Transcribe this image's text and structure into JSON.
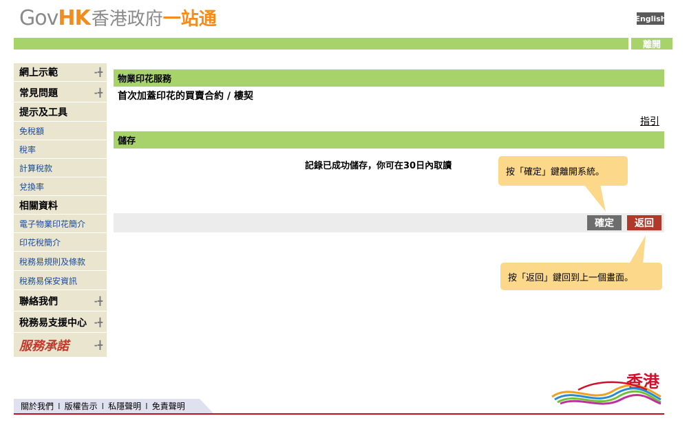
{
  "header": {
    "logo_gov": "Gov",
    "logo_hk": "HK",
    "logo_cn_grey": "香港政府",
    "logo_cn_orange": "一站通",
    "lang_button": "English",
    "exit_button": "離開"
  },
  "sidebar": {
    "items": [
      {
        "label": "網上示範",
        "type": "head",
        "arrow": true
      },
      {
        "label": "常見問題",
        "type": "head",
        "arrow": true
      },
      {
        "label": "提示及工具",
        "type": "head",
        "arrow": false
      },
      {
        "label": "免稅額",
        "type": "link"
      },
      {
        "label": "稅率",
        "type": "link"
      },
      {
        "label": "計算稅款",
        "type": "link"
      },
      {
        "label": "兌換率",
        "type": "link"
      },
      {
        "label": "相關資料",
        "type": "head",
        "arrow": false
      },
      {
        "label": "電子物業印花簡介",
        "type": "link"
      },
      {
        "label": "印花稅簡介",
        "type": "link"
      },
      {
        "label": "稅務易規則及條款",
        "type": "link"
      },
      {
        "label": "稅務易保安資訊",
        "type": "link"
      },
      {
        "label": "聯絡我們",
        "type": "head",
        "arrow": true
      },
      {
        "label": "稅務易支援中心",
        "type": "head",
        "arrow": true
      },
      {
        "label": "服務承諾",
        "type": "logo",
        "arrow": true
      }
    ],
    "arrow_glyph": "-╋"
  },
  "main": {
    "section_title": "物業印花服務",
    "subtitle": "首次加蓋印花的買賣合約 / 樓契",
    "guide_link": "指引",
    "save_section": "儲存",
    "message": "記錄已成功儲存，你可在30日內取讀",
    "ok_button": "確定",
    "back_button": "返回",
    "tip_ok": "按「確定」鍵離開系統。",
    "tip_back": "按「返回」鍵回到上一個畫面。"
  },
  "footer": {
    "links": [
      "關於我們",
      "版權告示",
      "私隱聲明",
      "免責聲明"
    ],
    "separator": "I",
    "brand_text": "香港"
  },
  "colors": {
    "green": "#a8d26a",
    "orange": "#f28c1e",
    "tip": "#fbd88a",
    "back": "#b03a2a",
    "red_line": "#c0101a"
  }
}
